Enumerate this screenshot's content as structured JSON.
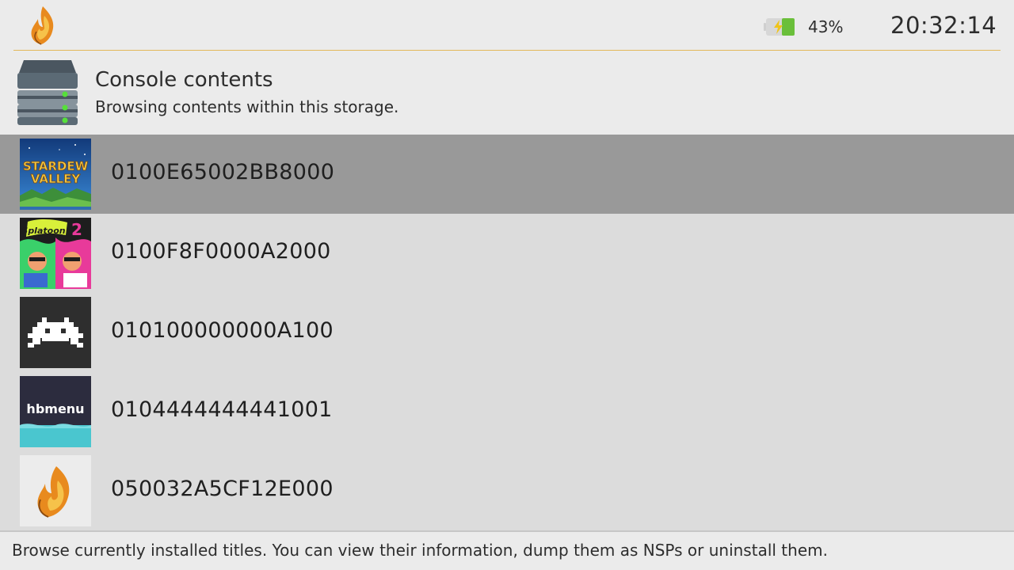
{
  "status": {
    "battery_percent": "43%",
    "battery_charging": true,
    "clock": "20:32:14",
    "accent_color": "#e3b85a"
  },
  "header": {
    "title": "Console contents",
    "subtitle": "Browsing contents within this storage.",
    "icon": "storage-drive-icon"
  },
  "titles": [
    {
      "id": "0100E65002BB8000",
      "icon": "stardew-valley-thumbnail",
      "selected": true
    },
    {
      "id": "0100F8F0000A2000",
      "icon": "splatoon-2-thumbnail",
      "selected": false
    },
    {
      "id": "010100000000A100",
      "icon": "retroarch-thumbnail",
      "selected": false
    },
    {
      "id": "0104444444441001",
      "icon": "hbmenu-thumbnail",
      "selected": false,
      "thumb_text": "hbmenu"
    },
    {
      "id": "050032A5CF12E000",
      "icon": "flame-logo-thumbnail",
      "selected": false
    }
  ],
  "footer": {
    "help_text": "Browse currently installed titles. You can view their information, dump them as NSPs or uninstall them."
  }
}
